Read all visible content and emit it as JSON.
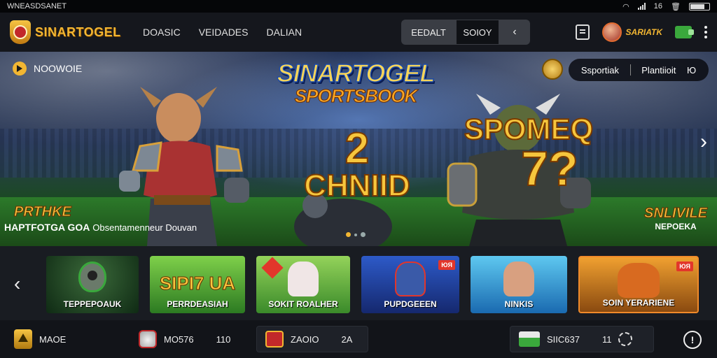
{
  "status_bar": {
    "left_text": "WNEASDSANET",
    "right_text": "16"
  },
  "header": {
    "logo_text": "SINARTOGEL",
    "nav": [
      "DOASIC",
      "VEIDADES",
      "DALIAN"
    ],
    "segment": {
      "option1": "EEDALT",
      "option2": "SOIOY",
      "chevron": "‹"
    },
    "user_name": "SARIATK"
  },
  "hero": {
    "top_left_label": "NOOWOIE",
    "title_line1": "SINARTOGEL",
    "title_line2": "SPORTSBOOK",
    "big_left_number": "2",
    "big_left_word": "CHNIID",
    "big_right_word": "SPOMEQ",
    "big_right_number": "7?",
    "pill_left": "Ssportiak",
    "pill_right": "Plantiioit",
    "pill_icon": "Ю",
    "next_arrow": "›",
    "bottom_left_title": "PRTHKE",
    "bottom_left_strong": "HAPTFOTGA GOA",
    "bottom_left_text": "Obsentamenneur Douvan",
    "bottom_right_title": "SNLIVILE",
    "bottom_right_text": "NEPOEKA",
    "active_slide": 1,
    "slide_count": 3
  },
  "games": {
    "prev_arrow": "‹",
    "cards": [
      {
        "label": "TEPPEPOAUK",
        "big": "",
        "badge": ""
      },
      {
        "label": "PERRDEASIAH",
        "big": "SIPI7 UA",
        "badge": ""
      },
      {
        "label": "SOKIT ROALHER",
        "big": "",
        "badge": ""
      },
      {
        "label": "PUPDGEEEN",
        "big": "",
        "badge": "ЮЯ"
      },
      {
        "label": "NINKIS",
        "big": "",
        "badge": ""
      },
      {
        "label": "SOIN YERARIENE",
        "big": "",
        "badge": "ЮЯ"
      }
    ]
  },
  "bottom_bar": {
    "item1_label": "MAOE",
    "item2_label": "MO576",
    "item2_value": "110",
    "item3_label": "ZAOIO",
    "item3_value": "2A",
    "item4_label": "SIIC637",
    "item4_value": "11",
    "alert_glyph": "!"
  }
}
